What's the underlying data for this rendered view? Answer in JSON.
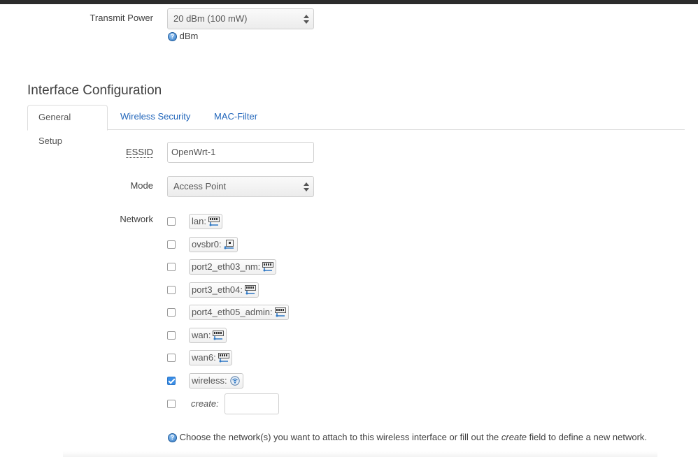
{
  "transmit_power": {
    "label": "Transmit Power",
    "selected": "20 dBm (100 mW)",
    "help": "dBm"
  },
  "section_title": "Interface Configuration",
  "tabs": [
    {
      "label": "General Setup",
      "active": true
    },
    {
      "label": "Wireless Security",
      "active": false
    },
    {
      "label": "MAC-Filter",
      "active": false
    }
  ],
  "essid": {
    "label": "ESSID",
    "value": "OpenWrt-1"
  },
  "mode": {
    "label": "Mode",
    "selected": "Access Point"
  },
  "network": {
    "label": "Network",
    "items": [
      {
        "label": "lan:",
        "checked": false,
        "icon": "ethernet-switch-icon"
      },
      {
        "label": "ovsbr0:",
        "checked": false,
        "icon": "ethernet-port-icon"
      },
      {
        "label": "port2_eth03_nm:",
        "checked": false,
        "icon": "ethernet-switch-icon"
      },
      {
        "label": "port3_eth04:",
        "checked": false,
        "icon": "ethernet-switch-icon"
      },
      {
        "label": "port4_eth05_admin:",
        "checked": false,
        "icon": "ethernet-switch-icon"
      },
      {
        "label": "wan:",
        "checked": false,
        "icon": "ethernet-switch-icon"
      },
      {
        "label": "wan6:",
        "checked": false,
        "icon": "ethernet-switch-icon"
      },
      {
        "label": "wireless:",
        "checked": true,
        "icon": "wifi-icon"
      }
    ],
    "create_label": "create:",
    "create_value": "",
    "help_prefix": "Choose the network(s) you want to attach to this wireless interface or fill out the ",
    "help_em": "create",
    "help_suffix": " field to define a new network."
  },
  "colors": {
    "link": "#2266bb",
    "checkbox_checked": "#3b8ee6",
    "help_icon": "#2f78c4"
  }
}
